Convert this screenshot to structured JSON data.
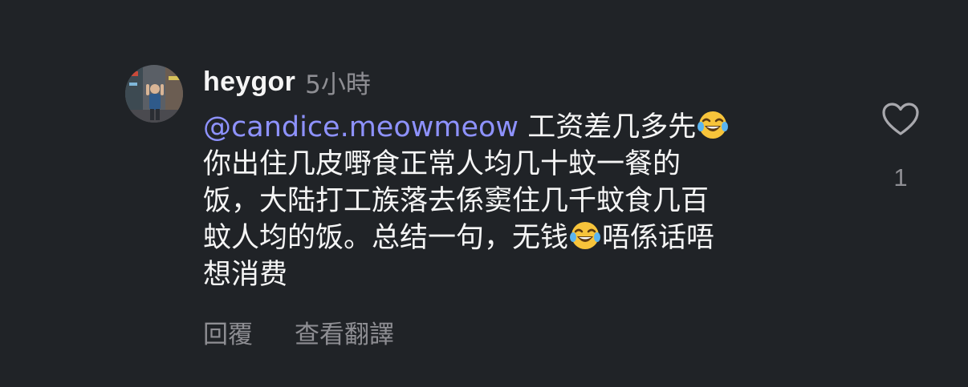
{
  "comment": {
    "username": "heygor",
    "timestamp": "5小時",
    "mention": "@candice.meowmeow",
    "body_lines": [
      " 工资差几多先",
      "你出住几皮嘢食正常人均几十蚊一餐的",
      "饭，大陆打工族落去係窦住几千蚊食几百",
      "蚊人均的饭。总结一句，无钱",
      "唔係话唔",
      "想消费"
    ],
    "emoji": "face-with-tears-of-joy"
  },
  "actions": {
    "reply": "回覆",
    "translate": "查看翻譯"
  },
  "like": {
    "icon": "heart-outline-icon",
    "count": "1"
  },
  "colors": {
    "background": "#202327",
    "text": "#f5f5f5",
    "muted": "#8e8e93",
    "mention": "#8e92ff"
  }
}
